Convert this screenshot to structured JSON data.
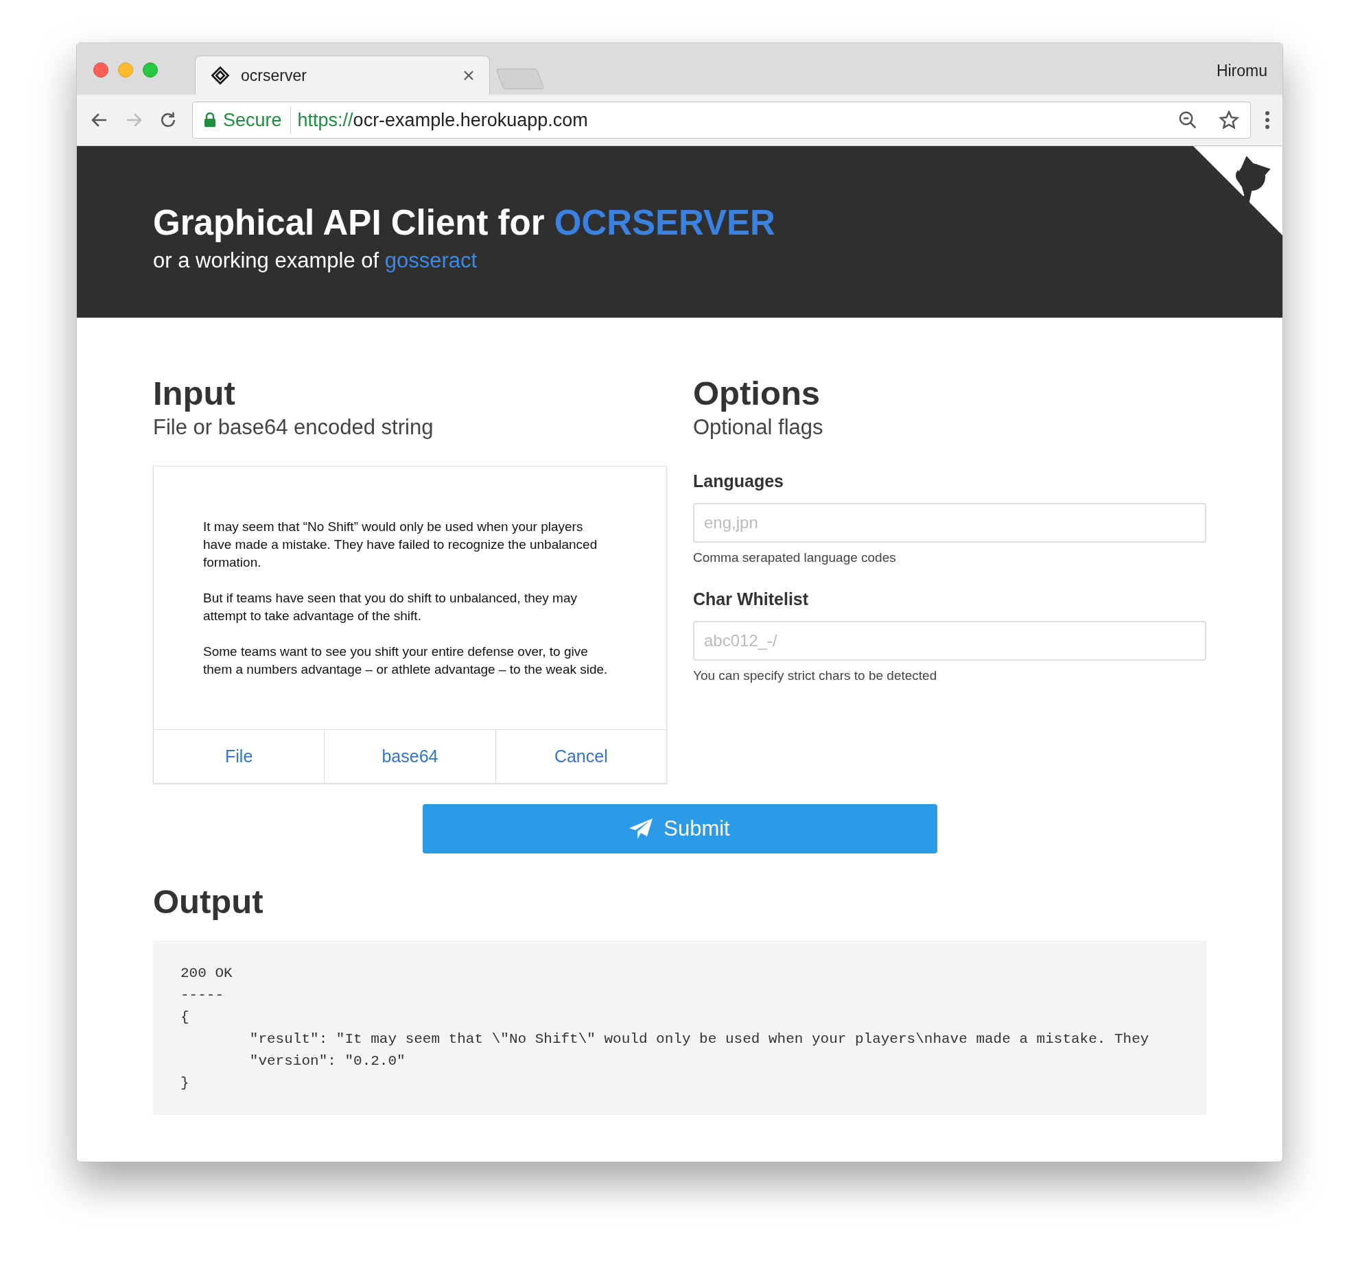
{
  "browser": {
    "tab_title": "ocrserver",
    "profile": "Hiromu",
    "secure_label": "Secure",
    "url_scheme": "https://",
    "url_rest": "ocr-example.herokuapp.com"
  },
  "header": {
    "title": "Graphical API Client for",
    "title_highlight": "OCRSERVER",
    "subtitle": "or a working example of",
    "subtitle_link": "gosseract"
  },
  "input": {
    "heading": "Input",
    "subheading": "File or base64 encoded string",
    "preview_paragraphs": [
      "It may seem that “No Shift” would only be used when your players have made a mistake. They have failed to recognize the unbalanced formation.",
      "But if teams have seen that you do shift to unbalanced, they may attempt to take advantage of the shift.",
      "Some teams want to see you shift your entire defense over, to give them a numbers advantage – or athlete advantage – to the weak side."
    ],
    "buttons": [
      "File",
      "base64",
      "Cancel"
    ]
  },
  "options": {
    "heading": "Options",
    "subheading": "Optional flags",
    "fields": [
      {
        "label": "Languages",
        "placeholder": "eng,jpn",
        "help": "Comma serapated language codes"
      },
      {
        "label": "Char Whitelist",
        "placeholder": "abc012_-/",
        "help": "You can specify strict chars to be detected"
      }
    ]
  },
  "submit": "Submit",
  "output": {
    "heading": "Output",
    "lines": [
      "200 OK",
      "-----",
      "{",
      "        \"result\": \"It may seem that \\\"No Shift\\\" would only be used when your players\\nhave made a mistake. They",
      "        \"version\": \"0.2.0\"",
      "}"
    ]
  }
}
